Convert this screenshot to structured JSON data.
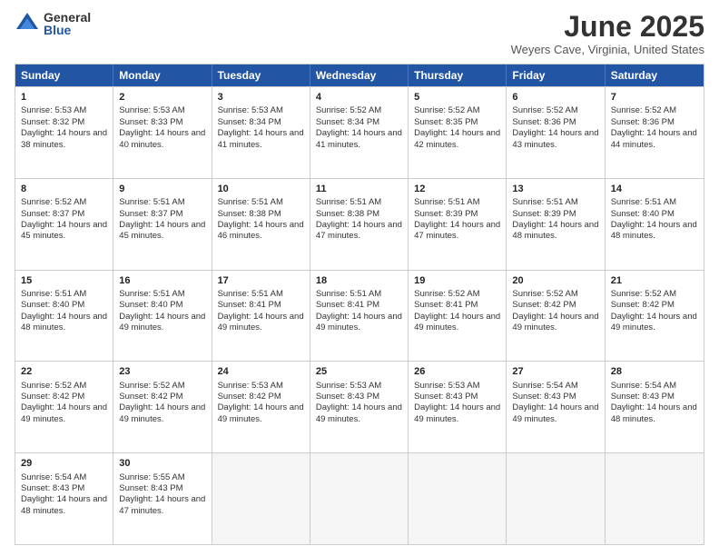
{
  "logo": {
    "general": "General",
    "blue": "Blue"
  },
  "title": "June 2025",
  "location": "Weyers Cave, Virginia, United States",
  "days_header": [
    "Sunday",
    "Monday",
    "Tuesday",
    "Wednesday",
    "Thursday",
    "Friday",
    "Saturday"
  ],
  "weeks": [
    [
      {
        "day": "1",
        "sunrise": "Sunrise: 5:53 AM",
        "sunset": "Sunset: 8:32 PM",
        "daylight": "Daylight: 14 hours and 38 minutes."
      },
      {
        "day": "2",
        "sunrise": "Sunrise: 5:53 AM",
        "sunset": "Sunset: 8:33 PM",
        "daylight": "Daylight: 14 hours and 40 minutes."
      },
      {
        "day": "3",
        "sunrise": "Sunrise: 5:53 AM",
        "sunset": "Sunset: 8:34 PM",
        "daylight": "Daylight: 14 hours and 41 minutes."
      },
      {
        "day": "4",
        "sunrise": "Sunrise: 5:52 AM",
        "sunset": "Sunset: 8:34 PM",
        "daylight": "Daylight: 14 hours and 41 minutes."
      },
      {
        "day": "5",
        "sunrise": "Sunrise: 5:52 AM",
        "sunset": "Sunset: 8:35 PM",
        "daylight": "Daylight: 14 hours and 42 minutes."
      },
      {
        "day": "6",
        "sunrise": "Sunrise: 5:52 AM",
        "sunset": "Sunset: 8:36 PM",
        "daylight": "Daylight: 14 hours and 43 minutes."
      },
      {
        "day": "7",
        "sunrise": "Sunrise: 5:52 AM",
        "sunset": "Sunset: 8:36 PM",
        "daylight": "Daylight: 14 hours and 44 minutes."
      }
    ],
    [
      {
        "day": "8",
        "sunrise": "Sunrise: 5:52 AM",
        "sunset": "Sunset: 8:37 PM",
        "daylight": "Daylight: 14 hours and 45 minutes."
      },
      {
        "day": "9",
        "sunrise": "Sunrise: 5:51 AM",
        "sunset": "Sunset: 8:37 PM",
        "daylight": "Daylight: 14 hours and 45 minutes."
      },
      {
        "day": "10",
        "sunrise": "Sunrise: 5:51 AM",
        "sunset": "Sunset: 8:38 PM",
        "daylight": "Daylight: 14 hours and 46 minutes."
      },
      {
        "day": "11",
        "sunrise": "Sunrise: 5:51 AM",
        "sunset": "Sunset: 8:38 PM",
        "daylight": "Daylight: 14 hours and 47 minutes."
      },
      {
        "day": "12",
        "sunrise": "Sunrise: 5:51 AM",
        "sunset": "Sunset: 8:39 PM",
        "daylight": "Daylight: 14 hours and 47 minutes."
      },
      {
        "day": "13",
        "sunrise": "Sunrise: 5:51 AM",
        "sunset": "Sunset: 8:39 PM",
        "daylight": "Daylight: 14 hours and 48 minutes."
      },
      {
        "day": "14",
        "sunrise": "Sunrise: 5:51 AM",
        "sunset": "Sunset: 8:40 PM",
        "daylight": "Daylight: 14 hours and 48 minutes."
      }
    ],
    [
      {
        "day": "15",
        "sunrise": "Sunrise: 5:51 AM",
        "sunset": "Sunset: 8:40 PM",
        "daylight": "Daylight: 14 hours and 48 minutes."
      },
      {
        "day": "16",
        "sunrise": "Sunrise: 5:51 AM",
        "sunset": "Sunset: 8:40 PM",
        "daylight": "Daylight: 14 hours and 49 minutes."
      },
      {
        "day": "17",
        "sunrise": "Sunrise: 5:51 AM",
        "sunset": "Sunset: 8:41 PM",
        "daylight": "Daylight: 14 hours and 49 minutes."
      },
      {
        "day": "18",
        "sunrise": "Sunrise: 5:51 AM",
        "sunset": "Sunset: 8:41 PM",
        "daylight": "Daylight: 14 hours and 49 minutes."
      },
      {
        "day": "19",
        "sunrise": "Sunrise: 5:52 AM",
        "sunset": "Sunset: 8:41 PM",
        "daylight": "Daylight: 14 hours and 49 minutes."
      },
      {
        "day": "20",
        "sunrise": "Sunrise: 5:52 AM",
        "sunset": "Sunset: 8:42 PM",
        "daylight": "Daylight: 14 hours and 49 minutes."
      },
      {
        "day": "21",
        "sunrise": "Sunrise: 5:52 AM",
        "sunset": "Sunset: 8:42 PM",
        "daylight": "Daylight: 14 hours and 49 minutes."
      }
    ],
    [
      {
        "day": "22",
        "sunrise": "Sunrise: 5:52 AM",
        "sunset": "Sunset: 8:42 PM",
        "daylight": "Daylight: 14 hours and 49 minutes."
      },
      {
        "day": "23",
        "sunrise": "Sunrise: 5:52 AM",
        "sunset": "Sunset: 8:42 PM",
        "daylight": "Daylight: 14 hours and 49 minutes."
      },
      {
        "day": "24",
        "sunrise": "Sunrise: 5:53 AM",
        "sunset": "Sunset: 8:42 PM",
        "daylight": "Daylight: 14 hours and 49 minutes."
      },
      {
        "day": "25",
        "sunrise": "Sunrise: 5:53 AM",
        "sunset": "Sunset: 8:43 PM",
        "daylight": "Daylight: 14 hours and 49 minutes."
      },
      {
        "day": "26",
        "sunrise": "Sunrise: 5:53 AM",
        "sunset": "Sunset: 8:43 PM",
        "daylight": "Daylight: 14 hours and 49 minutes."
      },
      {
        "day": "27",
        "sunrise": "Sunrise: 5:54 AM",
        "sunset": "Sunset: 8:43 PM",
        "daylight": "Daylight: 14 hours and 49 minutes."
      },
      {
        "day": "28",
        "sunrise": "Sunrise: 5:54 AM",
        "sunset": "Sunset: 8:43 PM",
        "daylight": "Daylight: 14 hours and 48 minutes."
      }
    ],
    [
      {
        "day": "29",
        "sunrise": "Sunrise: 5:54 AM",
        "sunset": "Sunset: 8:43 PM",
        "daylight": "Daylight: 14 hours and 48 minutes."
      },
      {
        "day": "30",
        "sunrise": "Sunrise: 5:55 AM",
        "sunset": "Sunset: 8:43 PM",
        "daylight": "Daylight: 14 hours and 47 minutes."
      },
      {
        "day": "",
        "sunrise": "",
        "sunset": "",
        "daylight": ""
      },
      {
        "day": "",
        "sunrise": "",
        "sunset": "",
        "daylight": ""
      },
      {
        "day": "",
        "sunrise": "",
        "sunset": "",
        "daylight": ""
      },
      {
        "day": "",
        "sunrise": "",
        "sunset": "",
        "daylight": ""
      },
      {
        "day": "",
        "sunrise": "",
        "sunset": "",
        "daylight": ""
      }
    ]
  ]
}
